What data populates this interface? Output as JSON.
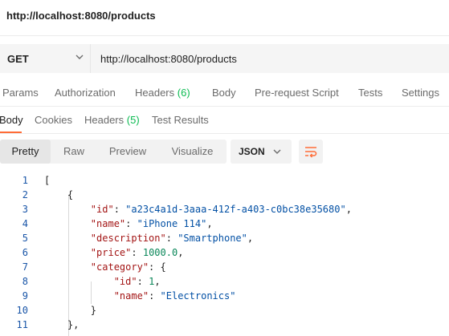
{
  "request": {
    "title": "http://localhost:8080/products",
    "method": "GET",
    "url": "http://localhost:8080/products"
  },
  "request_tabs": [
    {
      "label": "Params"
    },
    {
      "label": "Authorization"
    },
    {
      "label": "Headers",
      "count": "(6)"
    },
    {
      "label": "Body"
    },
    {
      "label": "Pre-request Script"
    },
    {
      "label": "Tests"
    },
    {
      "label": "Settings"
    }
  ],
  "response_tabs": [
    {
      "label": "Body"
    },
    {
      "label": "Cookies"
    },
    {
      "label": "Headers",
      "count": "(5)"
    },
    {
      "label": "Test Results"
    }
  ],
  "view_modes": [
    "Pretty",
    "Raw",
    "Preview",
    "Visualize"
  ],
  "active_view_mode": "Pretty",
  "format": "JSON",
  "icons": {
    "method_dropdown": "chevron-down-icon",
    "format_dropdown": "chevron-down-icon",
    "wrap": "wrap-lines-icon"
  },
  "colors": {
    "accent": "#ff6c37",
    "count": "#0cbb52",
    "key": "#a31515",
    "string": "#0451a5",
    "number": "#098658",
    "line_number": "#1a56a8"
  },
  "code_lines": [
    {
      "n": "1",
      "t": "["
    },
    {
      "n": "2",
      "t": "    {"
    },
    {
      "n": "3",
      "t": "        \"id\": \"a23c4a1d-3aaa-412f-a403-c0bc38e35680\","
    },
    {
      "n": "4",
      "t": "        \"name\": \"iPhone 114\","
    },
    {
      "n": "5",
      "t": "        \"description\": \"Smartphone\","
    },
    {
      "n": "6",
      "t": "        \"price\": 1000.0,"
    },
    {
      "n": "7",
      "t": "        \"category\": {"
    },
    {
      "n": "8",
      "t": "            \"id\": 1,"
    },
    {
      "n": "9",
      "t": "            \"name\": \"Electronics\""
    },
    {
      "n": "10",
      "t": "        }"
    },
    {
      "n": "11",
      "t": "    },"
    }
  ]
}
